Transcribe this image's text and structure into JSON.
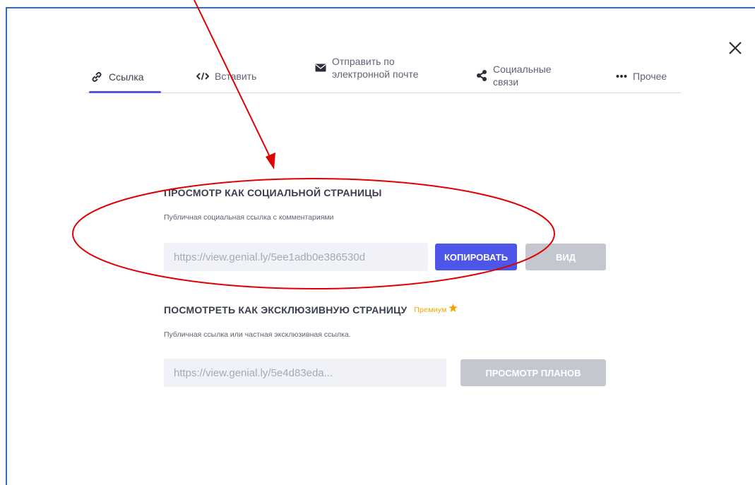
{
  "tabs": [
    {
      "label": "Ссылка",
      "icon": "link-icon",
      "active": true
    },
    {
      "label": "Вставить",
      "icon": "code-icon"
    },
    {
      "label": "Отправить по электронной почте",
      "icon": "mail-icon"
    },
    {
      "label": "Социальные связи",
      "icon": "share-icon"
    },
    {
      "label": "Прочее",
      "icon": "more-dots-icon"
    }
  ],
  "social": {
    "title": "ПРОСМОТР КАК СОЦИАЛЬНОЙ СТРАНИЦЫ",
    "subtitle": "Публичная социальная ссылка с комментариями",
    "url": "https://view.genial.ly/5ee1adb0e386530d",
    "copy_label": "КОПИРОВАТЬ",
    "view_label": "ВИД"
  },
  "exclusive": {
    "title": "ПОСМОТРЕТЬ КАК ЭКСКЛЮЗИВНУЮ СТРАНИЦУ",
    "premium_label": "Премиум",
    "subtitle": "Публичная ссылка или частная эксклюзивная ссылка.",
    "url": "https://view.genial.ly/5e4d83eda...",
    "plans_label": "ПРОСМОТР ПЛАНОВ"
  },
  "colors": {
    "accent": "#4c56e8",
    "active_tab": "#5a57d6",
    "premium": "#f0a500",
    "annotation": "#e00000",
    "frame": "#2f6db5"
  }
}
